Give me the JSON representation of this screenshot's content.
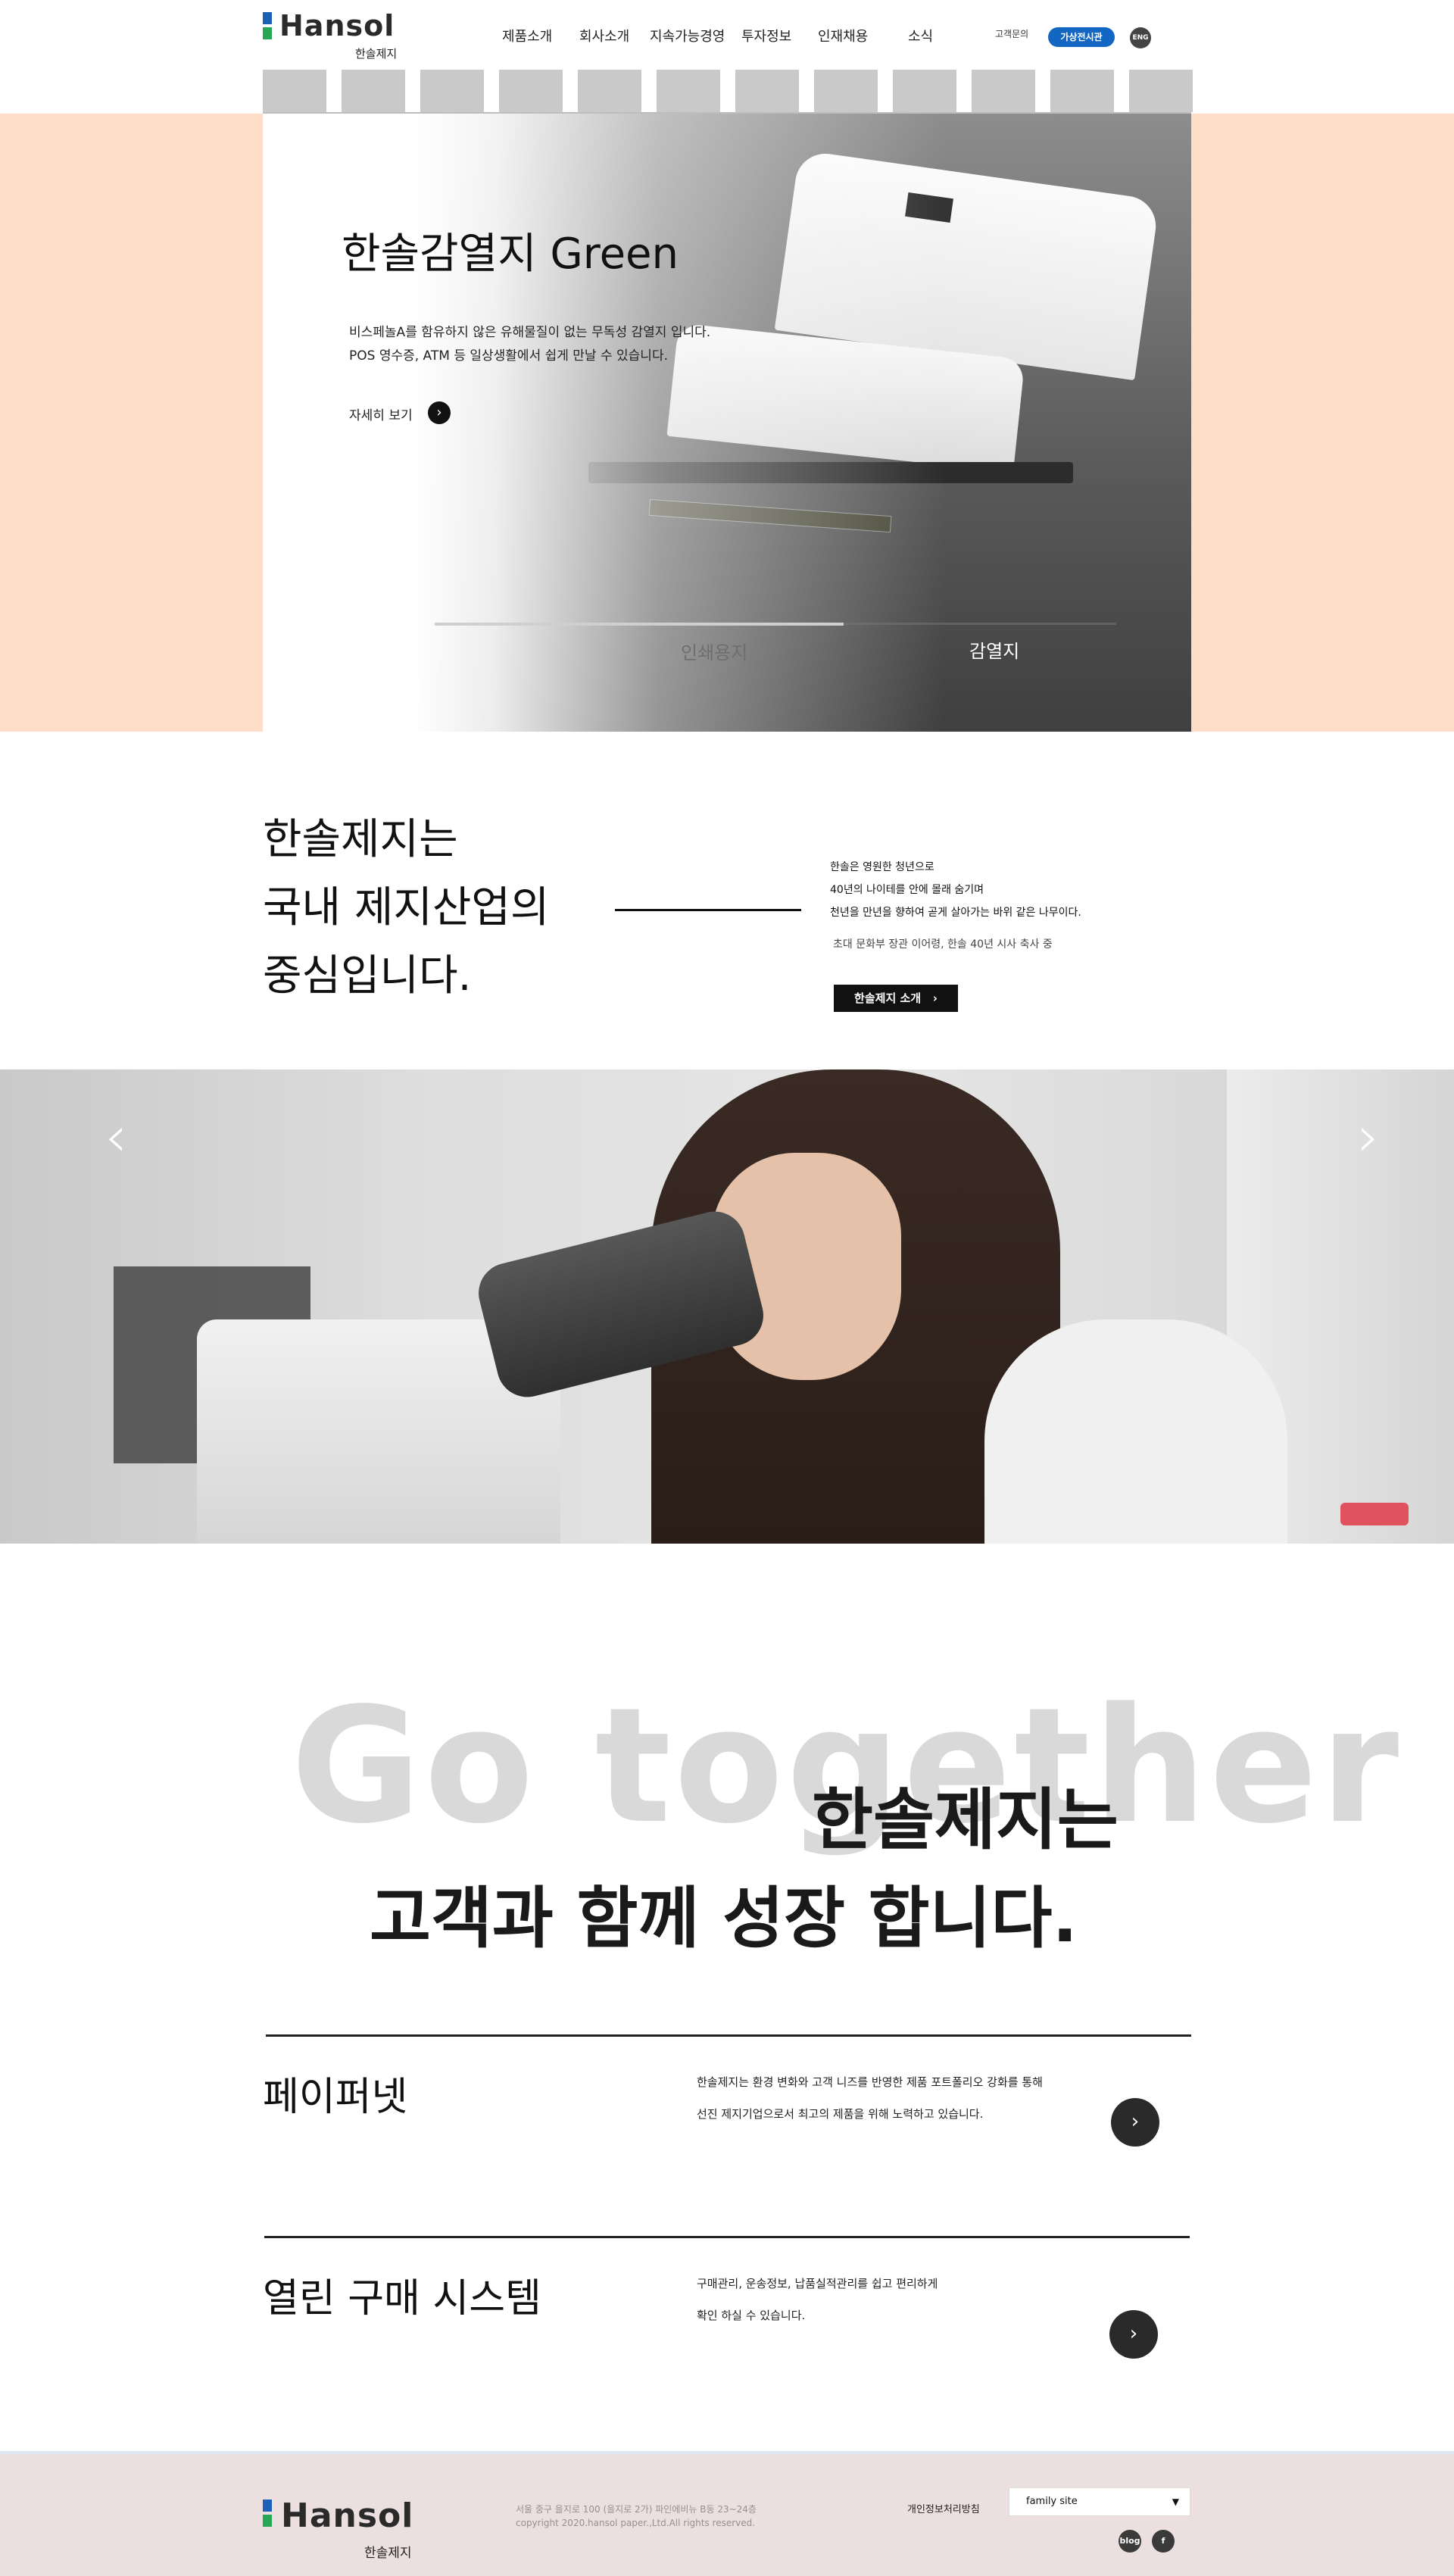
{
  "header": {
    "logo": {
      "wordmark": "Hansol",
      "sub": "한솔제지"
    },
    "nav": [
      "제품소개",
      "회사소개",
      "지속가능경영",
      "투자정보",
      "인재채용",
      "소식"
    ],
    "contact_label": "고객문의",
    "virtual_label": "가상전시관",
    "eng_label": "ENG"
  },
  "hero": {
    "title": "한솔감열지 Green",
    "desc": [
      "비스페놀A를 함유하지 않은 유해물질이 없는 무독성 감열지 입니다.",
      "POS 영수증, ATM 등 일상생활에서 쉽게 만날 수 있습니다."
    ],
    "more_label": "자세히 보기",
    "tabs": [
      "인쇄용지",
      "감열지"
    ],
    "progress": 0.6
  },
  "intro": {
    "title": [
      "한솔제지는",
      "국내 제지산업의",
      "중심입니다."
    ],
    "quote": [
      "한솔은 영원한 청년으로",
      "40년의 나이테를 안에 몰래 숨기며",
      "천년을 만년을 향하여 곧게 살아가는 바위 같은 나무이다."
    ],
    "cite": "초대 문화부 장관 이어령, 한솔 40년  시사 축사 중",
    "button_label": "한솔제지 소개"
  },
  "banner": {
    "prev": "‹",
    "next": "›"
  },
  "together": {
    "bg_text": "Go together",
    "line1": "한솔제지는",
    "line2": "고객과 함께 성장 합니다."
  },
  "services": [
    {
      "name": "페이퍼넷",
      "desc": [
        "한솔제지는 환경 변화와 고객 니즈를 반영한 제품 포트폴리오 강화를 통해",
        "선진 제지기업으로서 최고의 제품을 위해 노력하고 있습니다."
      ]
    },
    {
      "name": "열린 구매 시스템",
      "desc": [
        "구매관리, 운송정보, 납품실적관리를 쉽고 편리하게",
        "확인 하실 수 있습니다."
      ]
    }
  ],
  "footer": {
    "logo": {
      "wordmark": "Hansol",
      "sub": "한솔제지"
    },
    "address": "서울 중구 을지로 100 (을지로 2가) 파인에비뉴 B동 23~24층",
    "copyright": "copyright 2020.hansol paper.,Ltd.All rights reserved.",
    "privacy": "개인정보처리방침",
    "family_site": "family site",
    "sns": [
      "blog",
      "f"
    ]
  },
  "colors": {
    "accent_blue": "#1466c3",
    "hero_bg": "#ffdec9",
    "footer_bg": "#ebdfdf",
    "logo_blue": "#1b62b6",
    "logo_green": "#27a653"
  }
}
